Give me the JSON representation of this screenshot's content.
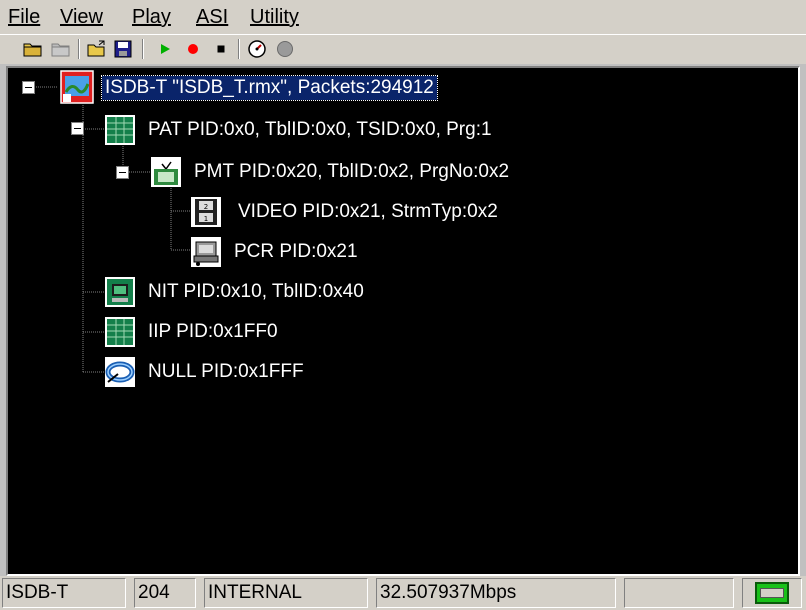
{
  "menu": {
    "file": "File",
    "view": "View",
    "play": "Play",
    "asi": "ASI",
    "utility": "Utility"
  },
  "toolbar": {
    "buttons": [
      "open-folder-icon",
      "close-folder-icon",
      "open-file-icon",
      "save-icon",
      "play-icon",
      "record-icon",
      "stop-icon",
      "speed-icon",
      "status-led-icon"
    ]
  },
  "tree": {
    "root": "ISDB-T \"ISDB_T.rmx\", Packets:294912",
    "pat": "PAT PID:0x0, TblID:0x0, TSID:0x0, Prg:1",
    "pmt": "PMT PID:0x20, TblID:0x2, PrgNo:0x2",
    "video": "VIDEO PID:0x21, StrmTyp:0x2",
    "pcr": "PCR PID:0x21",
    "nit": "NIT PID:0x10, TblID:0x40",
    "iip": "IIP PID:0x1FF0",
    "null": "NULL PID:0x1FFF"
  },
  "statusbar": {
    "standard": "ISDB-T",
    "packet_size": "204",
    "clock": "INTERNAL",
    "bitrate": "32.507937Mbps"
  }
}
